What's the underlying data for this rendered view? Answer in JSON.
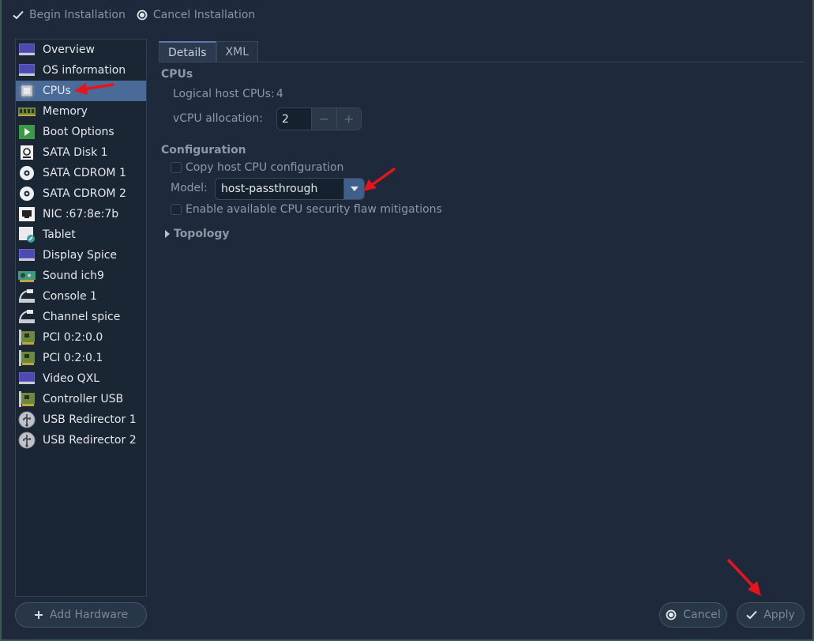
{
  "toolbar": {
    "begin_label": "Begin Installation",
    "cancel_label": "Cancel Installation"
  },
  "sidebar": {
    "selected_index": 2,
    "items": [
      {
        "label": "Overview",
        "icon": "monitor-icon"
      },
      {
        "label": "OS information",
        "icon": "monitor-icon"
      },
      {
        "label": "CPUs",
        "icon": "cpu-chip-icon"
      },
      {
        "label": "Memory",
        "icon": "memory-stick-icon"
      },
      {
        "label": "Boot Options",
        "icon": "boot-play-icon"
      },
      {
        "label": "SATA Disk 1",
        "icon": "disk-icon"
      },
      {
        "label": "SATA CDROM 1",
        "icon": "cdrom-icon"
      },
      {
        "label": "SATA CDROM 2",
        "icon": "cdrom-icon"
      },
      {
        "label": "NIC :67:8e:7b",
        "icon": "network-port-icon"
      },
      {
        "label": "Tablet",
        "icon": "tablet-icon"
      },
      {
        "label": "Display Spice",
        "icon": "monitor-icon"
      },
      {
        "label": "Sound ich9",
        "icon": "sound-card-icon"
      },
      {
        "label": "Console 1",
        "icon": "serial-console-icon"
      },
      {
        "label": "Channel spice",
        "icon": "serial-console-icon"
      },
      {
        "label": "PCI 0:2:0.0",
        "icon": "pci-card-icon"
      },
      {
        "label": "PCI 0:2:0.1",
        "icon": "pci-card-icon"
      },
      {
        "label": "Video QXL",
        "icon": "monitor-icon"
      },
      {
        "label": "Controller USB",
        "icon": "pci-card-icon"
      },
      {
        "label": "USB Redirector 1",
        "icon": "usb-icon"
      },
      {
        "label": "USB Redirector 2",
        "icon": "usb-icon"
      }
    ],
    "add_hardware_label": "Add Hardware"
  },
  "tabs": [
    {
      "label": "Details",
      "active": true
    },
    {
      "label": "XML",
      "active": false
    }
  ],
  "cpus": {
    "section_title": "CPUs",
    "logical_label": "Logical host CPUs:",
    "logical_value": "4",
    "vcpu_label": "vCPU allocation:",
    "vcpu_value": "2",
    "minus": "−",
    "plus": "+"
  },
  "configuration": {
    "section_title": "Configuration",
    "copy_host_label": "Copy host CPU configuration",
    "copy_host_checked": false,
    "model_label": "Model:",
    "model_value": "host-passthrough",
    "mitigations_label": "Enable available CPU security flaw mitigations",
    "mitigations_checked": false
  },
  "topology": {
    "label": "Topology",
    "expanded": false
  },
  "footer": {
    "cancel_label": "Cancel",
    "apply_label": "Apply"
  },
  "colors": {
    "background": "#1e2a3b",
    "selected": "#4a6a97",
    "annotation_arrow": "#e8141b"
  }
}
